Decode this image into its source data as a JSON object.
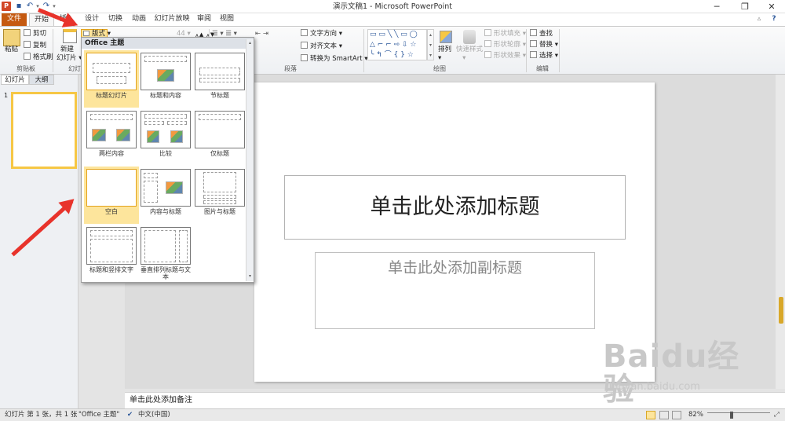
{
  "titlebar": {
    "title": "演示文稿1 - Microsoft PowerPoint"
  },
  "tabs": [
    "文件",
    "开始",
    "插入",
    "设计",
    "切换",
    "动画",
    "幻灯片放映",
    "审阅",
    "视图"
  ],
  "ribbon": {
    "clipboard": {
      "paste": "粘贴",
      "cut": "剪切",
      "copy": "复制",
      "format_painter": "格式刷",
      "label": "剪贴板"
    },
    "slides": {
      "new_slide": "新建",
      "new_slide2": "幻灯片",
      "layout": "版式",
      "label": "幻灯"
    },
    "paragraph": {
      "text_direction": "文字方向",
      "align_text": "对齐文本",
      "smartart": "转换为 SmartArt",
      "label": "段落"
    },
    "drawing": {
      "arrange": "排列",
      "quick_styles": "快速样式",
      "shape_fill": "形状填充",
      "shape_outline": "形状轮廓",
      "shape_effects": "形状效果",
      "label": "绘图"
    },
    "editing": {
      "find": "查找",
      "replace": "替换",
      "select": "选择",
      "label": "编辑"
    }
  },
  "left_panel": {
    "tab_slides": "幻灯片",
    "tab_outline": "大纲",
    "slide_number": "1"
  },
  "dropdown": {
    "header": "Office 主题",
    "layouts": [
      "标题幻灯片",
      "标题和内容",
      "节标题",
      "两栏内容",
      "比较",
      "仅标题",
      "空白",
      "内容与标题",
      "图片与标题",
      "标题和竖排文字",
      "垂直排列标题与文本"
    ]
  },
  "slide": {
    "title_placeholder": "单击此处添加标题",
    "subtitle_placeholder": "单击此处添加副标题"
  },
  "notes": {
    "placeholder": "单击此处添加备注"
  },
  "status": {
    "slide_info": "幻灯片 第 1 张，共 1 张",
    "theme": "\"Office 主题\"",
    "language": "中文(中国)",
    "zoom": "82%"
  },
  "watermark": {
    "brand": "Baidu经验",
    "url": "jingyan.baidu.com"
  },
  "colors": {
    "file_tab": "#c55a11",
    "selected_layout": "#fde59c",
    "arrow": "#e8332b"
  }
}
